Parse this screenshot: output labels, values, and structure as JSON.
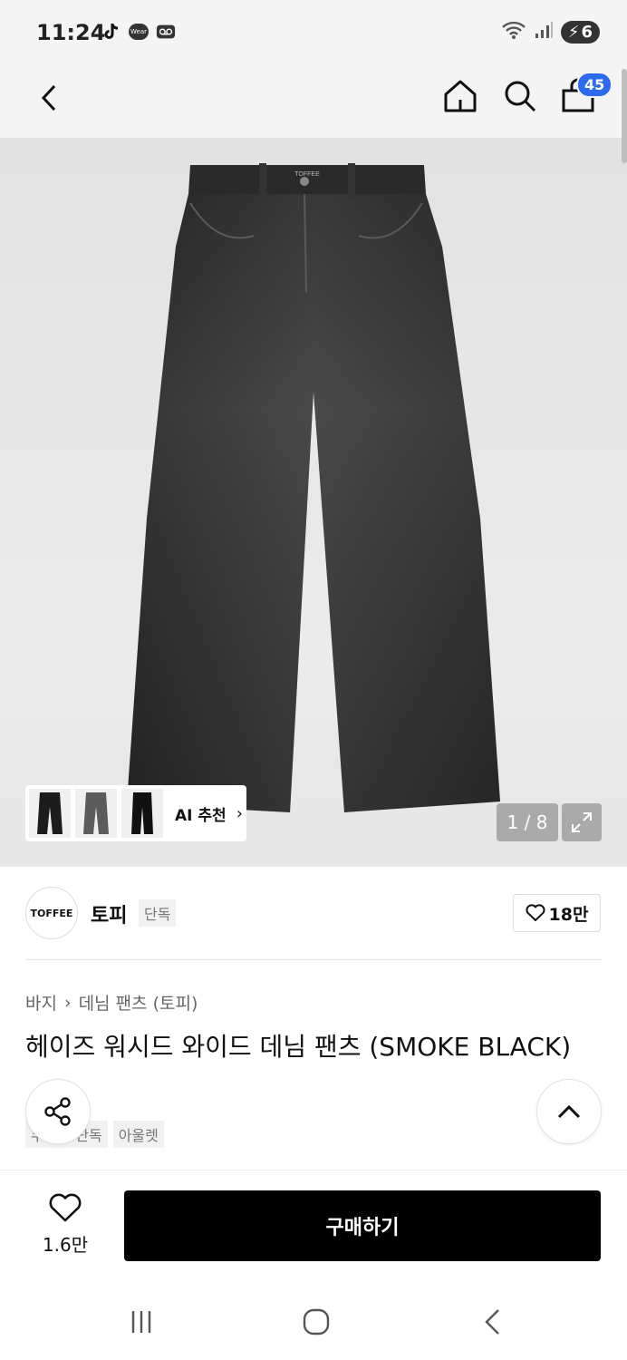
{
  "status": {
    "time": "11:24",
    "wear_label": "Wear",
    "battery": "6"
  },
  "nav": {
    "cart_count": "45"
  },
  "gallery": {
    "garment_label": "TOFFEE",
    "ai_label": "AI 추천",
    "counter": "1 / 8"
  },
  "brand": {
    "logo_text": "TOFFEE",
    "name": "토피",
    "badge": "단독",
    "likes": "18만"
  },
  "breadcrumb": {
    "category": "바지",
    "subcategory": "데님 팬츠 (토피)"
  },
  "product": {
    "title": "헤이즈 워시드 와이드 데님 팬츠 (SMOKE BLACK)",
    "tags": [
      "무신사 단독",
      "아울렛"
    ]
  },
  "bottom": {
    "wish_count": "1.6만",
    "buy_label": "구매하기"
  },
  "colors": {
    "accent": "#2c6bed",
    "buy_button": "#000000",
    "denim": "#2b2b2b"
  }
}
